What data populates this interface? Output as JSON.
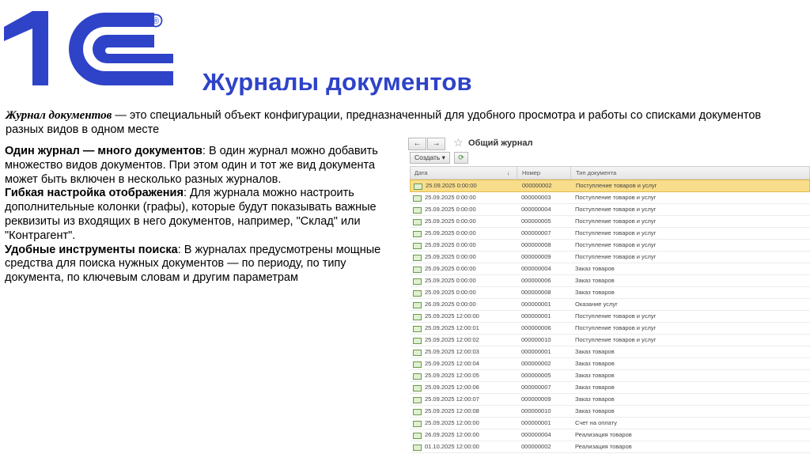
{
  "logo": {
    "text": "1C",
    "registered_mark": "®",
    "color": "#2e43c8"
  },
  "page_title": "Журналы документов",
  "intro": {
    "term": "Журнал документов",
    "dash": " — ",
    "text": "это специальный объект конфигурации, предназначенный для удобного просмотра и работы со списками документов разных видов в одном месте"
  },
  "points": [
    {
      "title": "Один журнал — много документов",
      "text": ": В один журнал можно добавить множество видов документов. При этом один и тот же вид документа может быть включен в несколько разных журналов."
    },
    {
      "title": "Гибкая настройка отображения",
      "text": ": Для журнала можно настроить дополнительные колонки (графы), которые будут показывать важные реквизиты из входящих в него документов, например, \"Склад\" или \"Контрагент\"."
    },
    {
      "title": "Удобные инструменты поиска",
      "text": ": В журналах предусмотрены мощные средства для поиска нужных документов — по периоду, по типу документа, по ключевым словам и другим параметрам"
    }
  ],
  "journal": {
    "title": "Общий журнал",
    "back_icon": "←",
    "forward_icon": "→",
    "star_icon": "☆",
    "create_label": "Создать ▾",
    "refresh_icon": "⟳",
    "columns": {
      "date": "Дата",
      "number": "Номер",
      "type": "Тип документа",
      "sort_mark": "↓"
    },
    "selected_row": 0,
    "rows": [
      {
        "date": "25.09.2025 0:00:00",
        "number": "000000002",
        "type": "Поступление товаров и услуг"
      },
      {
        "date": "25.09.2025 0:00:00",
        "number": "000000003",
        "type": "Поступление товаров и услуг"
      },
      {
        "date": "25.09.2025 0:00:00",
        "number": "000000004",
        "type": "Поступление товаров и услуг"
      },
      {
        "date": "25.09.2025 0:00:00",
        "number": "000000005",
        "type": "Поступление товаров и услуг"
      },
      {
        "date": "25.09.2025 0:00:00",
        "number": "000000007",
        "type": "Поступление товаров и услуг"
      },
      {
        "date": "25.09.2025 0:00:00",
        "number": "000000008",
        "type": "Поступление товаров и услуг"
      },
      {
        "date": "25.09.2025 0:00:00",
        "number": "000000009",
        "type": "Поступление товаров и услуг"
      },
      {
        "date": "25.09.2025 0:00:00",
        "number": "000000004",
        "type": "Заказ товаров"
      },
      {
        "date": "25.09.2025 0:00:00",
        "number": "000000006",
        "type": "Заказ товаров"
      },
      {
        "date": "25.09.2025 0:00:00",
        "number": "000000008",
        "type": "Заказ товаров"
      },
      {
        "date": "26.09.2025 0:00:00",
        "number": "000000001",
        "type": "Оказание услуг"
      },
      {
        "date": "25.09.2025 12:00:00",
        "number": "000000001",
        "type": "Поступление товаров и услуг"
      },
      {
        "date": "25.09.2025 12:00:01",
        "number": "000000006",
        "type": "Поступление товаров и услуг"
      },
      {
        "date": "25.09.2025 12:00:02",
        "number": "000000010",
        "type": "Поступление товаров и услуг"
      },
      {
        "date": "25.09.2025 12:00:03",
        "number": "000000001",
        "type": "Заказ товаров"
      },
      {
        "date": "25.09.2025 12:00:04",
        "number": "000000002",
        "type": "Заказ товаров"
      },
      {
        "date": "25.09.2025 12:00:05",
        "number": "000000005",
        "type": "Заказ товаров"
      },
      {
        "date": "25.09.2025 12:00:06",
        "number": "000000007",
        "type": "Заказ товаров"
      },
      {
        "date": "25.09.2025 12:00:07",
        "number": "000000009",
        "type": "Заказ товаров"
      },
      {
        "date": "25.09.2025 12:00:08",
        "number": "000000010",
        "type": "Заказ товаров"
      },
      {
        "date": "25.09.2025 12:00:00",
        "number": "000000001",
        "type": "Счет на оплату"
      },
      {
        "date": "26.09.2025 12:00:00",
        "number": "000000004",
        "type": "Реализация товаров"
      },
      {
        "date": "01.10.2025 12:00:00",
        "number": "000000002",
        "type": "Реализация товаров"
      }
    ]
  }
}
